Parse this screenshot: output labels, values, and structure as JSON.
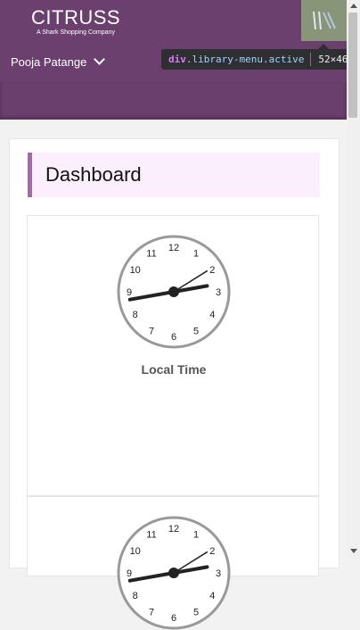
{
  "header": {
    "brand_name": "CITRUSS",
    "brand_tagline": "A Shark Shopping Company",
    "user_name": "Pooja Patange"
  },
  "tooltip": {
    "tag": "div",
    "classes": ".library-menu.active",
    "dimensions": "52×46"
  },
  "dashboard": {
    "title": "Dashboard",
    "clocks": [
      {
        "label": "Local Time"
      },
      {
        "label": ""
      }
    ],
    "clock_numbers": [
      "12",
      "1",
      "2",
      "3",
      "4",
      "5",
      "6",
      "7",
      "8",
      "9",
      "10",
      "11"
    ]
  },
  "colors": {
    "header_bg": "#6b3f6e",
    "title_accent": "#a06aa6",
    "title_bg": "#fbeefd",
    "library_menu_bg": "#8a9a7a"
  }
}
